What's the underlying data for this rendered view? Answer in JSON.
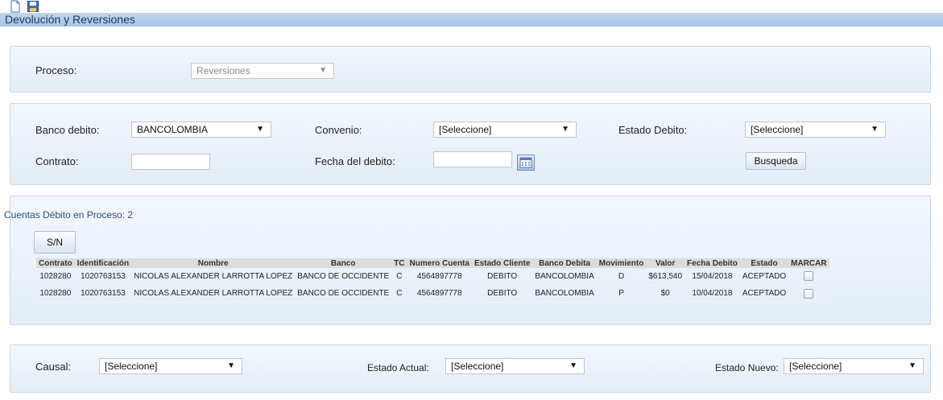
{
  "toolbar": {
    "icons": [
      "new-document-icon",
      "save-icon"
    ]
  },
  "page_title": "Devolución y Reversiones",
  "proceso": {
    "label": "Proceso:",
    "value": "Reversiones"
  },
  "filters": {
    "banco_label": "Banco debito:",
    "banco_value": "BANCOLOMBIA",
    "convenio_label": "Convenio:",
    "convenio_value": "[Seleccione]",
    "estado_label": "Estado Debito:",
    "estado_value": "[Seleccione]",
    "contrato_label": "Contrato:",
    "contrato_value": "",
    "fecha_label": "Fecha del debito:",
    "fecha_value": "",
    "search_label": "Busqueda"
  },
  "results": {
    "title": "Cuentas Débito en Proceso: 2",
    "sn_label": "S/N",
    "columns": [
      "Contrato",
      "Identificación",
      "Nombre",
      "Banco",
      "TC",
      "Numero Cuenta",
      "Estado Cliente",
      "Banco Debita",
      "Movimiento",
      "Valor",
      "Fecha Debito",
      "Estado",
      "MARCAR"
    ],
    "rows": [
      [
        "1028280",
        "1020763153",
        "NICOLAS ALEXANDER LARROTTA LOPEZ",
        "BANCO DE OCCIDENTE",
        "C",
        "4564897778",
        "DEBITO",
        "BANCOLOMBIA",
        "D",
        "$613,540",
        "15/04/2018",
        "ACEPTADO"
      ],
      [
        "1028280",
        "1020763153",
        "NICOLAS ALEXANDER LARROTTA LOPEZ",
        "BANCO DE OCCIDENTE",
        "C",
        "4564897778",
        "DEBITO",
        "BANCOLOMBIA",
        "P",
        "$0",
        "10/04/2018",
        "ACEPTADO"
      ]
    ]
  },
  "bottom": {
    "causal_label": "Causal:",
    "causal_value": "[Seleccione]",
    "actual_label": "Estado Actual:",
    "actual_value": "[Seleccione]",
    "nuevo_label": "Estado Nuevo:",
    "nuevo_value": "[Seleccione]"
  },
  "colors": {
    "title_bar": "#b7cde8",
    "panel": "#e8eff8",
    "header_row": "#dcdcdc"
  }
}
